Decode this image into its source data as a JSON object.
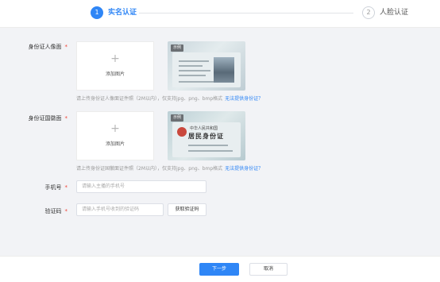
{
  "steps": [
    {
      "number": "1",
      "label": "实名认证",
      "active": true
    },
    {
      "number": "2",
      "label": "人脸认证",
      "active": false
    }
  ],
  "form": {
    "front": {
      "label": "身份证人像面",
      "required": "*",
      "upload_plus": "+",
      "upload_text": "添加图片",
      "sample_tag": "示例",
      "hint": "请上传身份证人像面证件照（2M以内），仅支持jpg、png、bmp格式",
      "hint_link": "无法提供身份证？"
    },
    "back": {
      "label": "身份证国徽面",
      "required": "*",
      "upload_plus": "+",
      "upload_text": "添加图片",
      "sample_tag": "示例",
      "sample_title_small": "中华人民共和国",
      "sample_title_big": "居民身份证",
      "hint": "请上传身份证国徽面证件照（2M以内），仅支持jpg、png、bmp格式",
      "hint_link": "无法提供身份证？"
    },
    "phone": {
      "label": "手机号",
      "required": "*",
      "placeholder": "请输入主播的手机号"
    },
    "code": {
      "label": "验证码",
      "required": "*",
      "placeholder": "请输入手机号收到的验证码",
      "button": "获取验证码"
    }
  },
  "footer": {
    "next": "下一步",
    "cancel": "取消"
  },
  "colors": {
    "accent": "#2f86f6",
    "required": "#f04134",
    "background": "#f2f3f6"
  }
}
